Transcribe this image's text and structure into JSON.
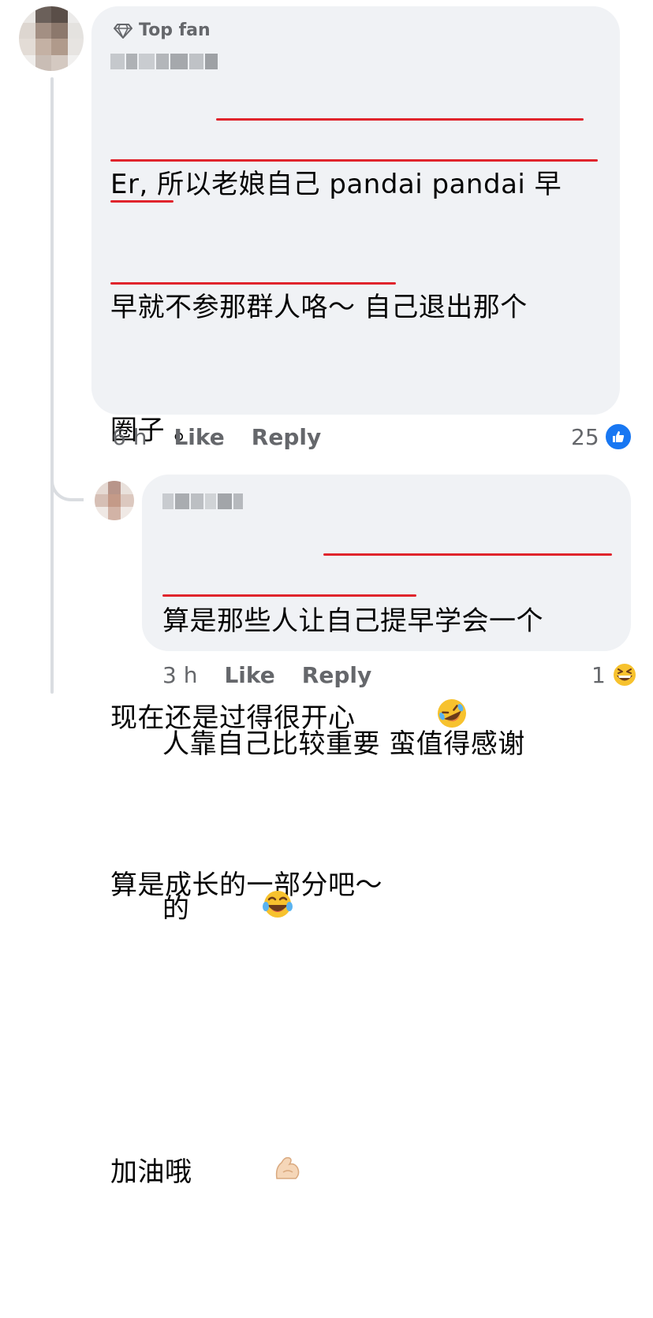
{
  "comments": [
    {
      "badge": "Top fan",
      "badge_icon": "diamond-icon",
      "author_blurred": true,
      "lines": [
        "Er, 所以老娘自己 pandai pandai 早",
        "早就不参那群人咯～ 自己退出那个",
        "圈子 。",
        "",
        "现在还是过得很开心",
        "算是成长的一部分吧～",
        "",
        "加油哦"
      ],
      "emojis": [
        "rolling-on-floor-laughing-emoji",
        "flexed-biceps-emoji"
      ],
      "time": "6 h",
      "like_label": "Like",
      "reply_label": "Reply",
      "reaction_count": "25",
      "reaction_icon": "like-reaction-icon"
    },
    {
      "author_blurred": true,
      "lines": [
        "算是那些人让自己提早学会一个",
        "人靠自己比较重要 蛮值得感谢",
        "的"
      ],
      "emojis": [
        "tears-of-joy-emoji"
      ],
      "time": "3 h",
      "like_label": "Like",
      "reply_label": "Reply",
      "reaction_count": "1",
      "reaction_icon": "grinning-squinting-reaction-icon"
    }
  ],
  "colors": {
    "bubble": "#f0f2f5",
    "meta": "#65676b",
    "underline": "#e0242c",
    "like": "#1877f2"
  }
}
